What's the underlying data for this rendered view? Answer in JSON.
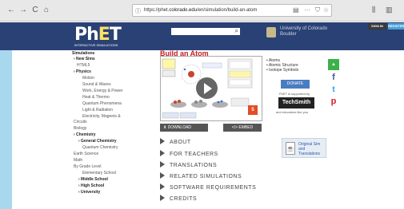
{
  "browser": {
    "url_prefix": "https://phet.",
    "url_domain": "colorado.edu",
    "url_path": "/en/simulation/build-an-atom",
    "back_icon": "←",
    "forward_icon": "→",
    "reload_icon": "C",
    "home_icon": "⌂",
    "lock_icon": "ⓘ",
    "reader_icon": "▤",
    "more_icon": "···",
    "pocket_icon": "⛉",
    "star_icon": "☆",
    "library_icon": "⫼",
    "sidebar_icon": "▥"
  },
  "header": {
    "logo_ph": "Ph",
    "logo_e": "E",
    "logo_t": "T",
    "logo_sub": "INTERACTIVE SIMULATIONS",
    "search_icon": "⌕",
    "cu_line1": "University of Colorado",
    "cu_line2": "Boulder",
    "signin": "SIGN IN",
    "register": "REGISTER"
  },
  "sidebar": {
    "simulations": "Simulations",
    "new_sims": "› New Sims",
    "html5": "HTML5",
    "physics": "› Physics",
    "motion": "Motion",
    "sound_waves": "Sound & Waves",
    "work_energy": "Work, Energy & Power",
    "heat_thermo": "Heat & Thermo",
    "quantum_phen": "Quantum Phenomena",
    "light_rad": "Light & Radiation",
    "elec_mag_1": "Electricity, Magnets &",
    "elec_mag_2": "Circuits",
    "biology": "Biology",
    "chemistry": "› Chemistry",
    "general_chem": "› General Chemistry",
    "quantum_chem": "Quantum Chemistry",
    "earth_science": "Earth Science",
    "math": "Math",
    "by_grade": "By Grade Level",
    "elementary": "Elementary School",
    "middle": "› Middle School",
    "high": "› High School",
    "university": "› University"
  },
  "main": {
    "title": "Build an Atom",
    "html5_badge": "5",
    "download": "⬇  DOWNLOAD",
    "embed": "</>  EMBED",
    "topics": [
      "• Atoms",
      "• Atomic Structure",
      "• Isotope Symbols"
    ],
    "donate": "DONATE",
    "supported_by": "PhET is supported by",
    "techsmith": "TechSmith",
    "techsmith_sub": "and educators like you",
    "facebook_icon": "f",
    "twitter_icon": "t",
    "pinterest_icon": "p",
    "share_icon": "▲",
    "sections": [
      "ABOUT",
      "FOR TEACHERS",
      "TRANSLATIONS",
      "RELATED SIMULATIONS",
      "SOFTWARE REQUIREMENTS",
      "CREDITS"
    ],
    "original_sim_1": "Original Sim and",
    "original_sim_2": "Translations",
    "java_icon": "☕"
  },
  "colors": {
    "header_bg": "#2a4175",
    "title_red": "#c41e1e",
    "leftbar": "#a8d8ee"
  }
}
